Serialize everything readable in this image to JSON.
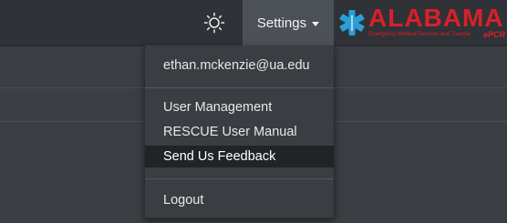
{
  "navbar": {
    "brightness_icon": "sun-brightness-icon",
    "settings_label": "Settings",
    "caret_icon": "caret-down-icon"
  },
  "logo": {
    "text": "ALABAMA",
    "subtitle": "Emergency Medical Services and Trauma",
    "tag": "ePCR",
    "icon": "star-of-life-icon",
    "color": "#d8202a",
    "star_color": "#2a9fd8"
  },
  "dropdown": {
    "user_email": "ethan.mckenzie@ua.edu",
    "items": [
      {
        "label": "User Management"
      },
      {
        "label": "RESCUE User Manual"
      },
      {
        "label": "Send Us Feedback"
      }
    ],
    "logout_label": "Logout"
  }
}
